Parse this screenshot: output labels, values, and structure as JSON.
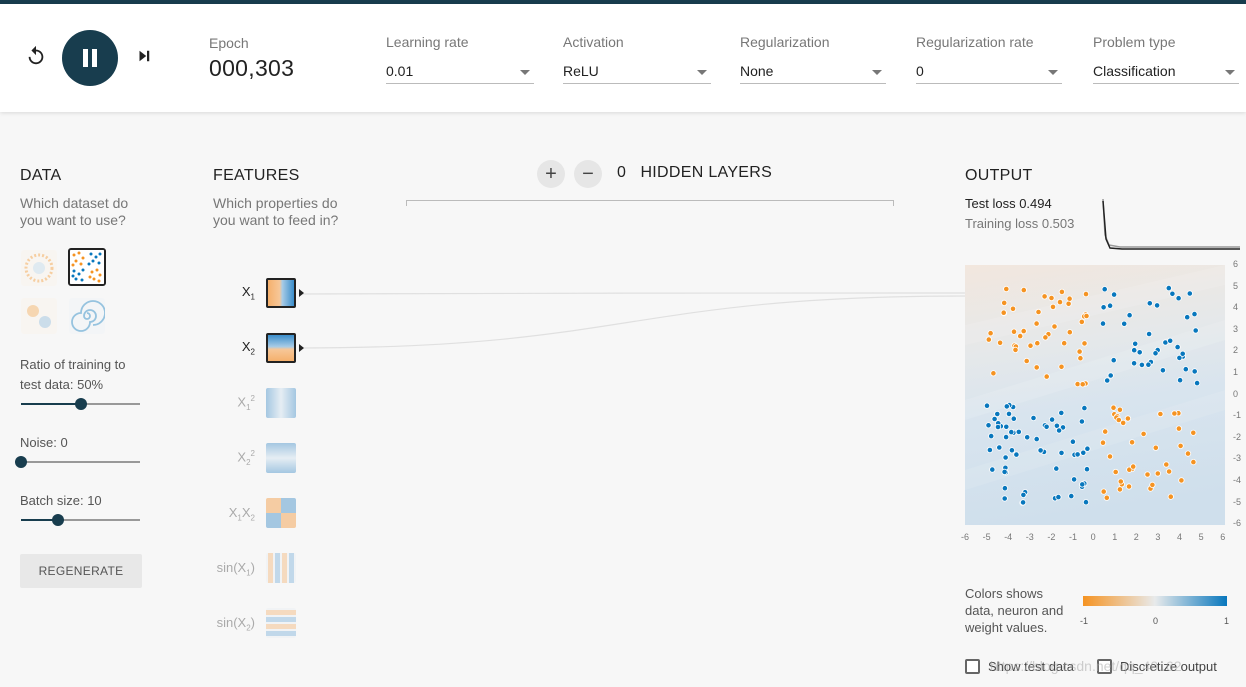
{
  "controls": {
    "epoch_label": "Epoch",
    "epoch_value": "000,303"
  },
  "dropdowns": [
    {
      "label": "Learning rate",
      "value": "0.01"
    },
    {
      "label": "Activation",
      "value": "ReLU"
    },
    {
      "label": "Regularization",
      "value": "None"
    },
    {
      "label": "Regularization rate",
      "value": "0"
    },
    {
      "label": "Problem type",
      "value": "Classification"
    }
  ],
  "data_panel": {
    "title": "DATA",
    "subtitle_line1": "Which dataset do",
    "subtitle_line2": "you want to use?",
    "selected_dataset": "xor",
    "ratio_label_line1": "Ratio of training to",
    "ratio_label_line2": "test data:  50%",
    "ratio_value": 0.5,
    "noise_label": "Noise:  0",
    "noise_value": 0,
    "batch_label": "Batch size:  10",
    "batch_value": 0.3,
    "regenerate_label": "REGENERATE"
  },
  "features_panel": {
    "title": "FEATURES",
    "subtitle_line1": "Which properties do",
    "subtitle_line2": "you want to feed in?",
    "features": [
      {
        "label": "X1",
        "active": true
      },
      {
        "label": "X2",
        "active": true
      },
      {
        "label": "X1²",
        "active": false
      },
      {
        "label": "X2²",
        "active": false
      },
      {
        "label": "X1X2",
        "active": false
      },
      {
        "label": "sin(X1)",
        "active": false
      },
      {
        "label": "sin(X2)",
        "active": false
      }
    ]
  },
  "network": {
    "hidden_layers_count": "0",
    "hidden_layers_label": "HIDDEN LAYERS",
    "add_symbol": "+",
    "remove_symbol": "−"
  },
  "output_panel": {
    "title": "OUTPUT",
    "test_loss_label": "Test loss",
    "test_loss_value": "0.494",
    "training_loss_label": "Training loss",
    "training_loss_value": "0.503",
    "y_ticks": [
      "6",
      "5",
      "4",
      "3",
      "2",
      "1",
      "0",
      "-1",
      "-2",
      "-3",
      "-4",
      "-5",
      "-6"
    ],
    "x_ticks": [
      "-6",
      "-5",
      "-4",
      "-3",
      "-2",
      "-1",
      "0",
      "1",
      "2",
      "3",
      "4",
      "5",
      "6"
    ],
    "legend_line1": "Colors shows",
    "legend_line2": "data, neuron and",
    "legend_line3": "weight values.",
    "legend_min": "-1",
    "legend_mid": "0",
    "legend_max": "1",
    "show_test_data_label": "Show test data",
    "discretize_label": "Discretize output",
    "colors": {
      "orange": "#f59322",
      "blue": "#0877bd",
      "dark": "#183d4e"
    }
  },
  "watermark": "https://blog.csdn.net/qq_40..62"
}
